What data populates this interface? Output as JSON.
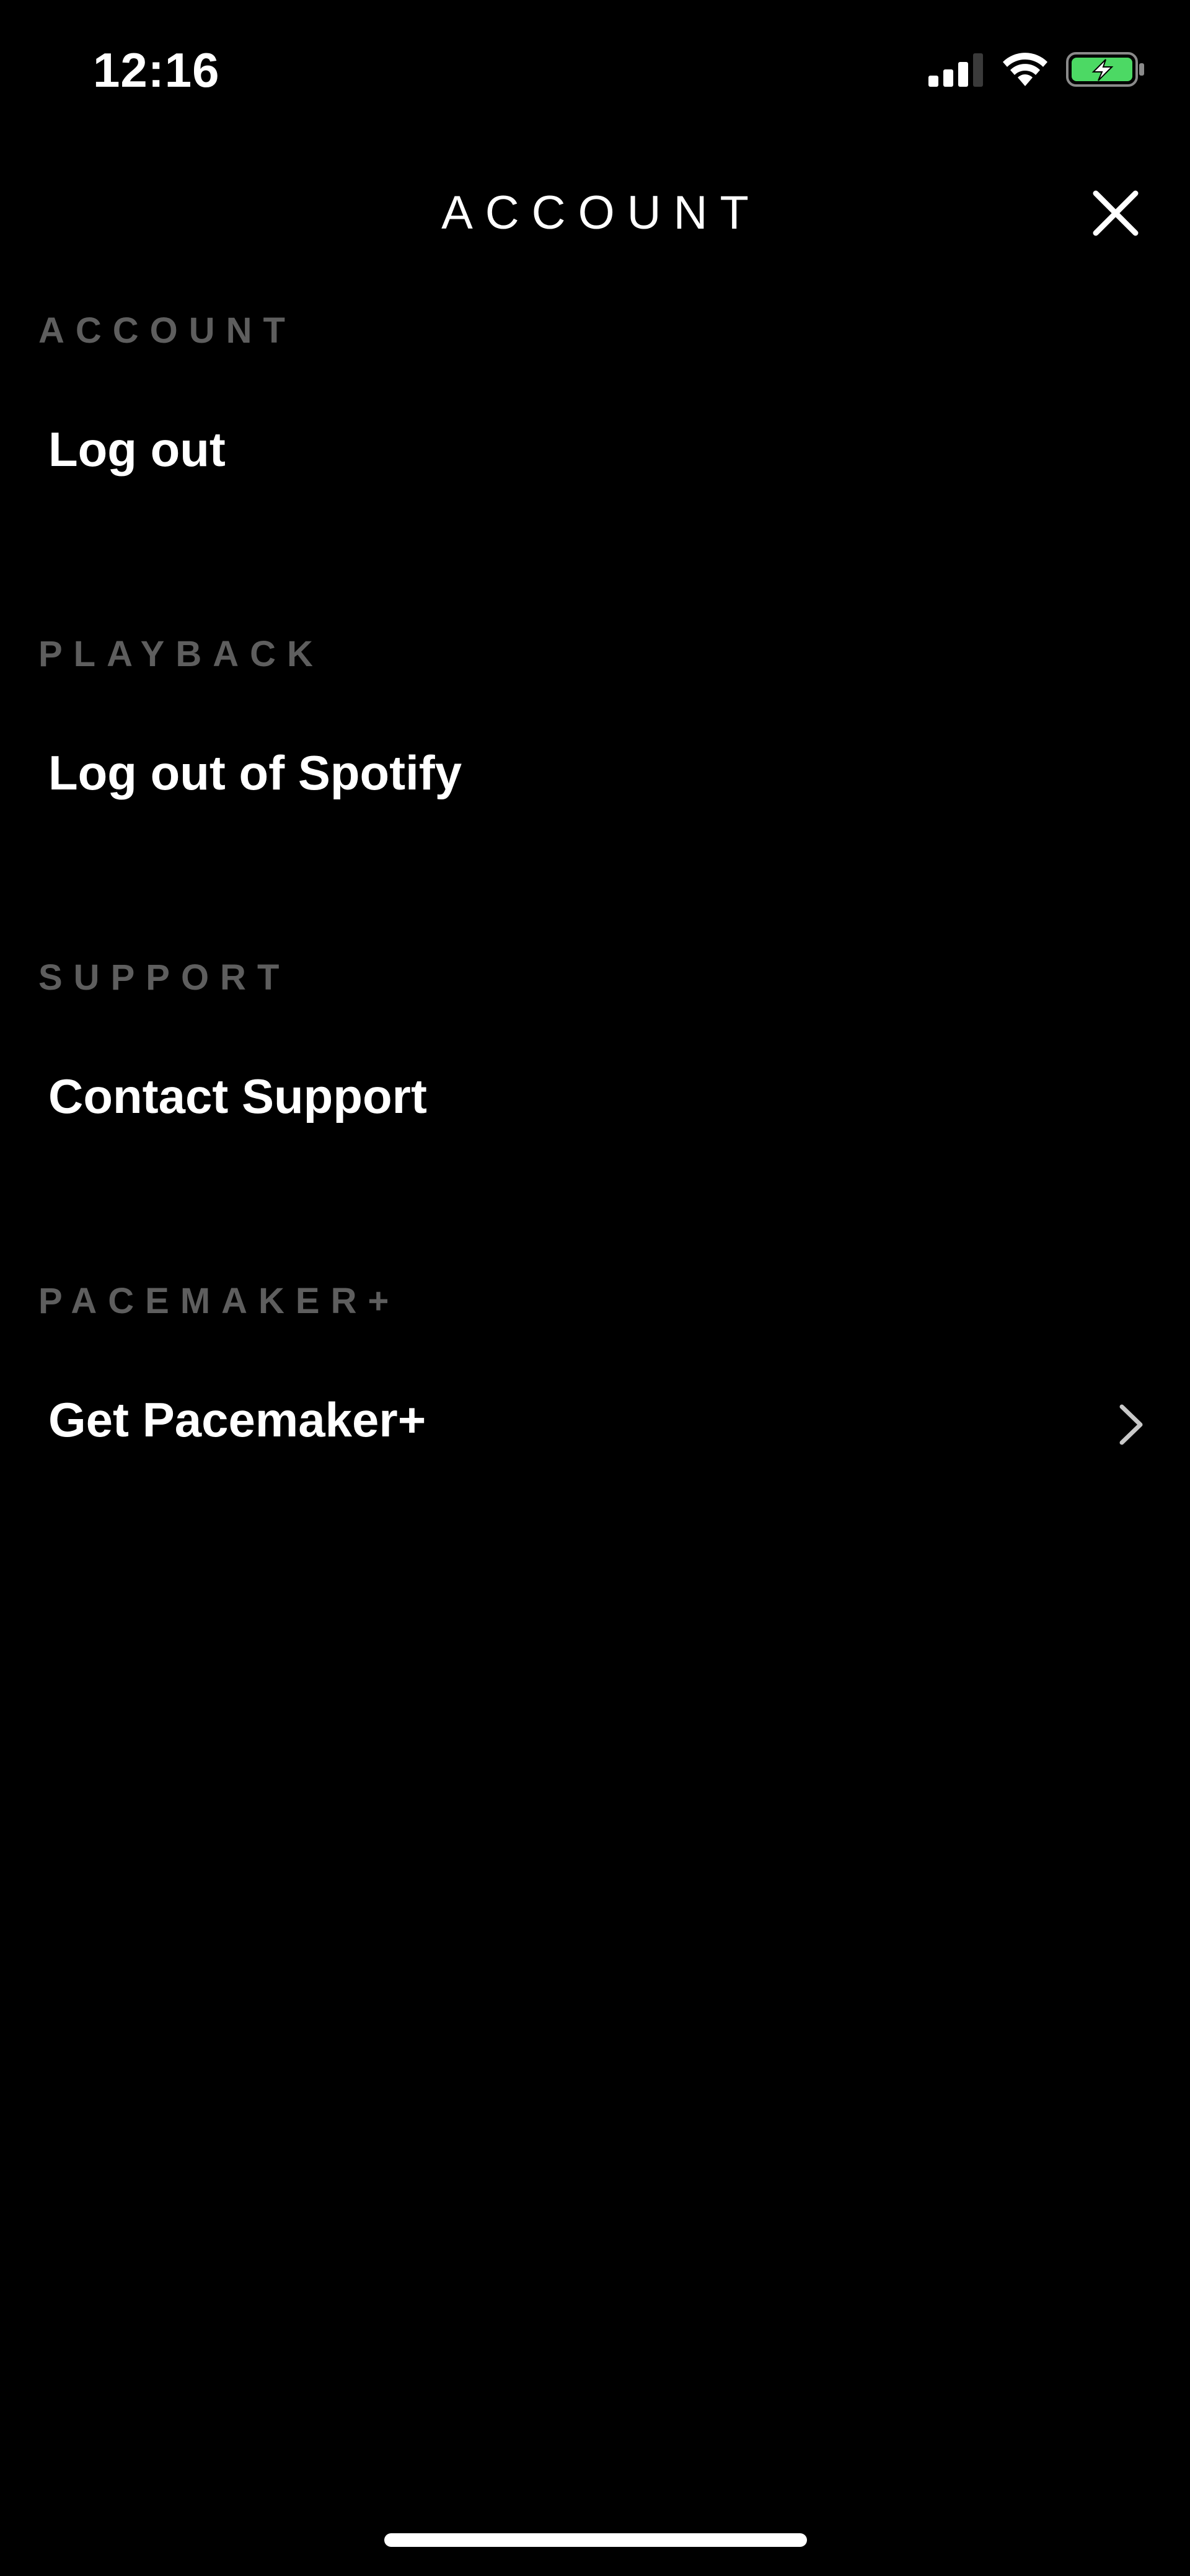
{
  "status_bar": {
    "time": "12:16",
    "battery_color": "#4cd964"
  },
  "header": {
    "title": "ACCOUNT",
    "close_icon": "close-icon"
  },
  "sections": [
    {
      "header": "ACCOUNT",
      "item_label": "Log out",
      "has_chevron": false
    },
    {
      "header": "PLAYBACK",
      "item_label": "Log out of Spotify",
      "has_chevron": false
    },
    {
      "header": "SUPPORT",
      "item_label": "Contact Support",
      "has_chevron": false
    },
    {
      "header": "PACEMAKER+",
      "item_label": "Get Pacemaker+",
      "has_chevron": true
    }
  ],
  "colors": {
    "background": "#000000",
    "text_primary": "#ffffff",
    "section_header": "#5e5e5e"
  }
}
